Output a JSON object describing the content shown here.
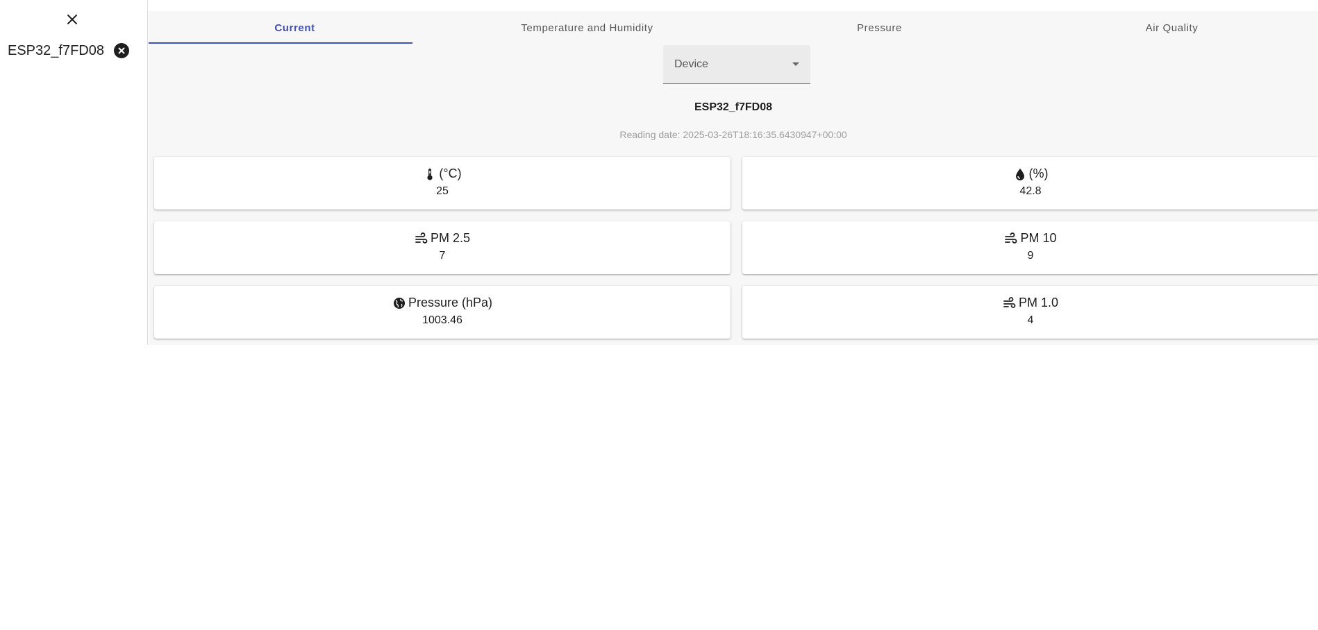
{
  "sidebar": {
    "close_icon": "close-icon",
    "device_chip": {
      "label": "ESP32_f7FD08",
      "remove_icon": "cancel-icon"
    }
  },
  "tabs": [
    {
      "label": "Current",
      "active": true
    },
    {
      "label": "Temperature and Humidity",
      "active": false
    },
    {
      "label": "Pressure",
      "active": false
    },
    {
      "label": "Air Quality",
      "active": false
    }
  ],
  "device_select": {
    "label": "Device"
  },
  "device_name": "ESP32_f7FD08",
  "reading_date": "Reading date: 2025-03-26T18:16:35.6430947+00:00",
  "cards": [
    {
      "icon": "thermometer-icon",
      "title": "(°C)",
      "value": "25"
    },
    {
      "icon": "water-drop-icon",
      "title": "(%)",
      "value": "42.8"
    },
    {
      "icon": "air-icon",
      "title": "PM 2.5",
      "value": "7"
    },
    {
      "icon": "air-icon",
      "title": "PM 10",
      "value": "9"
    },
    {
      "icon": "globe-icon",
      "title": "Pressure (hPa)",
      "value": "1003.46"
    },
    {
      "icon": "air-icon",
      "title": "PM 1.0",
      "value": "4"
    }
  ],
  "colors": {
    "accent": "#3f51b5",
    "panel_bg": "#f7f7f7",
    "muted_text": "#9e9e9e"
  }
}
